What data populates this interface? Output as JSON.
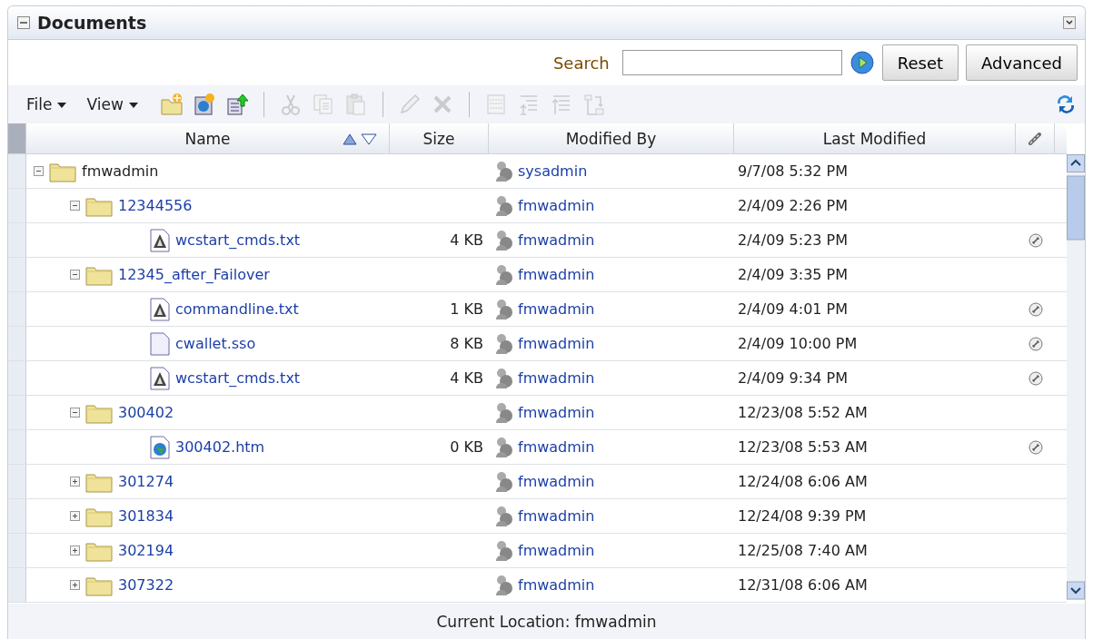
{
  "panel": {
    "title": "Documents",
    "expanded": true
  },
  "search": {
    "label": "Search",
    "buttons": [
      "Reset",
      "Advanced"
    ]
  },
  "toolbar": {
    "menus": [
      "File",
      "View"
    ],
    "tools": [
      {
        "kind": "new-folder",
        "disabled": false
      },
      {
        "kind": "new-web",
        "disabled": false
      },
      {
        "kind": "upload",
        "disabled": false
      },
      {
        "kind": "sep"
      },
      {
        "kind": "cut",
        "disabled": true
      },
      {
        "kind": "copy",
        "disabled": true
      },
      {
        "kind": "paste",
        "disabled": true
      },
      {
        "kind": "sep"
      },
      {
        "kind": "edit",
        "disabled": true
      },
      {
        "kind": "delete",
        "disabled": true
      },
      {
        "kind": "sep"
      },
      {
        "kind": "rename",
        "disabled": true
      },
      {
        "kind": "indent",
        "disabled": true
      },
      {
        "kind": "outdent",
        "disabled": true
      },
      {
        "kind": "move",
        "disabled": true
      }
    ]
  },
  "table": {
    "columns": [
      "Name",
      "Size",
      "Modified By",
      "Last Modified"
    ],
    "rows": [
      {
        "kind": "folder",
        "name": "fmwadmin",
        "modified_by": "sysadmin",
        "last_modified": "9/7/08 5:32 PM",
        "linked": false,
        "expanded": true,
        "children": [
          {
            "kind": "folder",
            "name": "12344556",
            "modified_by": "fmwadmin",
            "last_modified": "2/4/09 2:26 PM",
            "linked": false,
            "expanded": true,
            "children": [
              {
                "kind": "text",
                "name": "wcstart_cmds.txt",
                "size": "4 KB",
                "modified_by": "fmwadmin",
                "last_modified": "2/4/09 5:23 PM",
                "linked": true
              }
            ]
          },
          {
            "kind": "folder",
            "name": "12345_after_Failover",
            "modified_by": "fmwadmin",
            "last_modified": "2/4/09 3:35 PM",
            "linked": false,
            "expanded": true,
            "children": [
              {
                "kind": "text",
                "name": "commandline.txt",
                "size": "1 KB",
                "modified_by": "fmwadmin",
                "last_modified": "2/4/09 4:01 PM",
                "linked": true
              },
              {
                "kind": "file",
                "name": "cwallet.sso",
                "size": "8 KB",
                "modified_by": "fmwadmin",
                "last_modified": "2/4/09 10:00 PM",
                "linked": true
              },
              {
                "kind": "text",
                "name": "wcstart_cmds.txt",
                "size": "4 KB",
                "modified_by": "fmwadmin",
                "last_modified": "2/4/09 9:34 PM",
                "linked": true
              }
            ]
          },
          {
            "kind": "folder",
            "name": "300402",
            "modified_by": "fmwadmin",
            "last_modified": "12/23/08 5:52 AM",
            "linked": false,
            "expanded": true,
            "children": [
              {
                "kind": "web",
                "name": "300402.htm",
                "size": "0 KB",
                "modified_by": "fmwadmin",
                "last_modified": "12/23/08 5:53 AM",
                "linked": true
              }
            ]
          },
          {
            "kind": "folder",
            "name": "301274",
            "modified_by": "fmwadmin",
            "last_modified": "12/24/08 6:06 AM",
            "linked": false,
            "expanded": false
          },
          {
            "kind": "folder",
            "name": "301834",
            "modified_by": "fmwadmin",
            "last_modified": "12/24/08 9:39 PM",
            "linked": false,
            "expanded": false
          },
          {
            "kind": "folder",
            "name": "302194",
            "modified_by": "fmwadmin",
            "last_modified": "12/25/08 7:40 AM",
            "linked": false,
            "expanded": false
          },
          {
            "kind": "folder",
            "name": "307322",
            "modified_by": "fmwadmin",
            "last_modified": "12/31/08 6:06 AM",
            "linked": false,
            "expanded": false
          }
        ]
      }
    ]
  },
  "status_bar": "Current Location: fmwadmin"
}
